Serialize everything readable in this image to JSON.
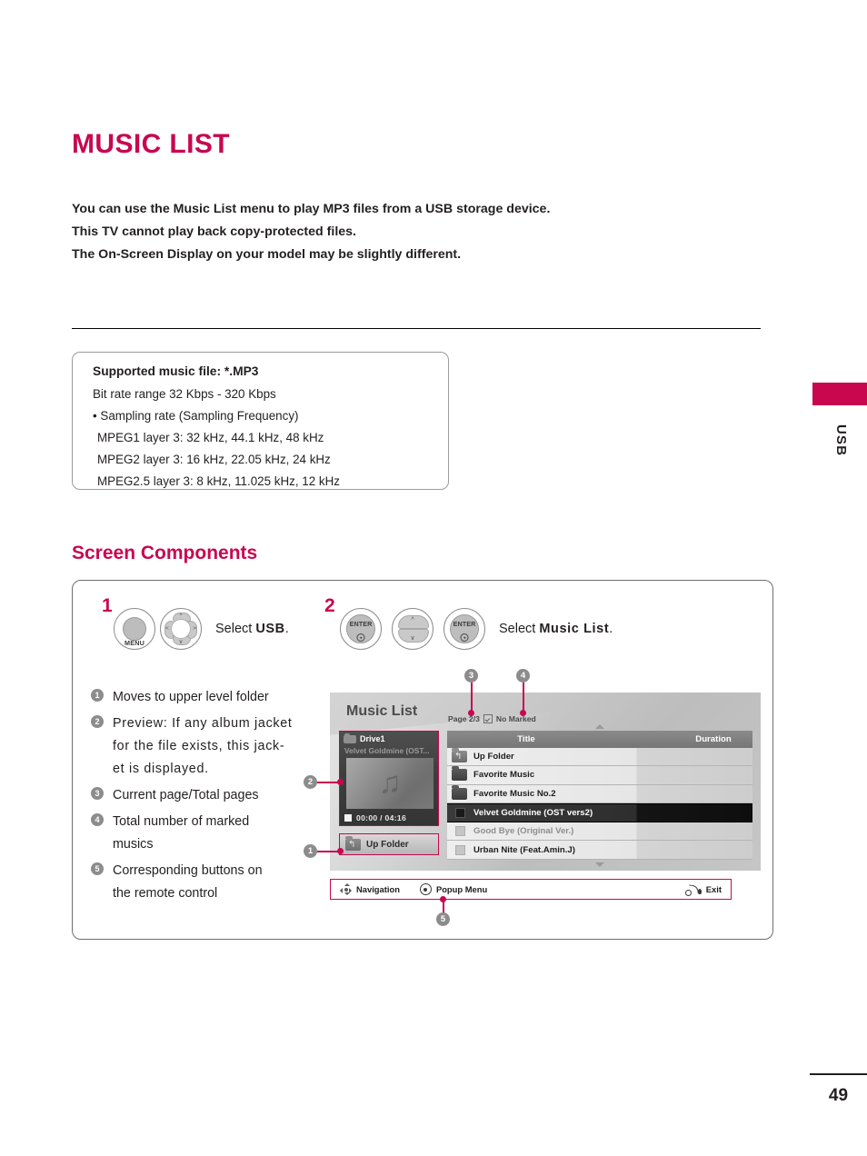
{
  "document": {
    "title": "MUSIC LIST",
    "page_number": "49",
    "side_tab": "USB",
    "accent_color": "#c8074f"
  },
  "intro": {
    "line1": "You can use the Music List menu to play MP3 files from a USB storage device.",
    "line2": "This TV cannot play back copy-protected files.",
    "line3": "The On-Screen Display on your model may be slightly different."
  },
  "spec_box": {
    "line0": "Supported music file: *.MP3",
    "line1": "Bit rate range 32 Kbps - 320 Kbps",
    "line2": "• Sampling rate (Sampling Frequency)",
    "line3": "MPEG1 layer 3: 32 kHz, 44.1 kHz, 48 kHz",
    "line4": "MPEG2 layer 3: 16 kHz, 22.05  kHz, 24 kHz",
    "line5": "MPEG2.5 layer 3: 8 kHz, 11.025 kHz, 12 kHz"
  },
  "section": {
    "heading": "Screen Components"
  },
  "steps": [
    {
      "number": "1",
      "keys": [
        "MENU",
        "nav-4way"
      ],
      "instruction_prefix": "Select ",
      "instruction_target": "USB",
      "instruction_suffix": "."
    },
    {
      "number": "2",
      "keys": [
        "ENTER",
        "nav-updown",
        "ENTER"
      ],
      "instruction_prefix": "Select ",
      "instruction_target": "Music List",
      "instruction_suffix": "."
    }
  ],
  "key_labels": {
    "menu": "MENU",
    "enter": "ENTER"
  },
  "features": [
    {
      "num": "1",
      "text": "Moves to upper level folder",
      "spaced": false
    },
    {
      "num": "2",
      "text": "Preview: If any album jacket",
      "spaced": true
    },
    {
      "num": "2b",
      "text": "for the file exists, this jack-",
      "spaced": true
    },
    {
      "num": "2c",
      "text": "et is displayed.",
      "spaced": true
    },
    {
      "num": "3",
      "text": "Current page/Total pages",
      "spaced": false
    },
    {
      "num": "4",
      "text": "Total number of marked",
      "spaced": false
    },
    {
      "num": "4b",
      "text": "musics",
      "spaced": false
    },
    {
      "num": "5",
      "text": "Corresponding buttons on",
      "spaced": false
    },
    {
      "num": "5b",
      "text": "the remote control",
      "spaced": false
    }
  ],
  "osd": {
    "title": "Music List",
    "page_indicator": "Page 2/3",
    "marked_status": "No Marked",
    "drive_name": "Drive1",
    "preview_track": "Velvet Goldmine (OST...",
    "preview_time": "00:00 / 04:16",
    "up_folder_button": "Up Folder",
    "columns": {
      "title": "Title",
      "duration": "Duration"
    },
    "rows": [
      {
        "label": "Up Folder",
        "icon": "up-folder-icon",
        "state": "normal",
        "duration": ""
      },
      {
        "label": "Favorite Music",
        "icon": "folder-icon",
        "state": "normal",
        "duration": ""
      },
      {
        "label": "Favorite Music No.2",
        "icon": "folder-icon",
        "state": "normal",
        "duration": ""
      },
      {
        "label": "Velvet Goldmine (OST vers2)",
        "icon": "music-icon",
        "state": "selected",
        "duration": ""
      },
      {
        "label": "Good Bye (Original Ver.)",
        "icon": "music-icon",
        "state": "dim",
        "duration": ""
      },
      {
        "label": "Urban Nite (Feat.Amin.J)",
        "icon": "music-icon",
        "state": "normal",
        "duration": ""
      }
    ],
    "navbar": {
      "navigation": "Navigation",
      "popup_menu": "Popup Menu",
      "exit": "Exit"
    }
  },
  "callouts": [
    {
      "id": "1",
      "target": "up-folder-button"
    },
    {
      "id": "2",
      "target": "preview-panel"
    },
    {
      "id": "3",
      "target": "page-indicator"
    },
    {
      "id": "4",
      "target": "marked-status"
    },
    {
      "id": "5",
      "target": "navbar"
    }
  ]
}
